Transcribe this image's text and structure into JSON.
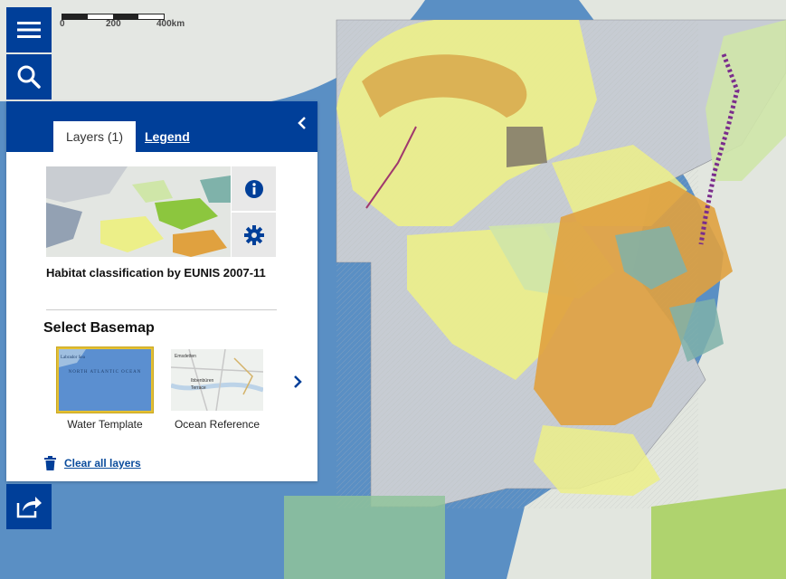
{
  "scalebar": {
    "labels": [
      "0",
      "200",
      "400km"
    ]
  },
  "tools": {
    "menu_icon": "hamburger-menu-icon",
    "search_icon": "search-icon",
    "share_icon": "share-icon"
  },
  "panel": {
    "tabs": [
      {
        "label": "Layers (1)",
        "active": true
      },
      {
        "label": "Legend",
        "active": false
      }
    ],
    "collapse_icon": "chevron-left-icon",
    "layer": {
      "title": "Habitat classification by EUNIS 2007-11",
      "info_icon": "info-icon",
      "settings_icon": "gear-icon"
    },
    "basemap": {
      "heading": "Select Basemap",
      "options": [
        {
          "name": "Water Template",
          "selected": true,
          "thumb_labels": [
            "Labrador Sea",
            "NORTH ATLANTIC OCEAN"
          ]
        },
        {
          "name": "Ocean Reference",
          "selected": false,
          "thumb_labels": [
            "Emsdetten",
            "Ibbenbüren",
            "Terrace"
          ]
        }
      ],
      "next_icon": "chevron-right-icon"
    },
    "clear": {
      "label": "Clear all layers",
      "icon": "trash-icon"
    }
  },
  "colors": {
    "brand_blue": "#003f99",
    "link_blue": "#0b4c9c",
    "selected_border": "#e4c033",
    "ocean": "#5a8fc4",
    "land": "#e2e6df",
    "eunis_yellow": "#ecef88",
    "eunis_orange": "#e0a13f",
    "eunis_green": "#8cc63e",
    "eunis_teal": "#7fb2aa"
  }
}
